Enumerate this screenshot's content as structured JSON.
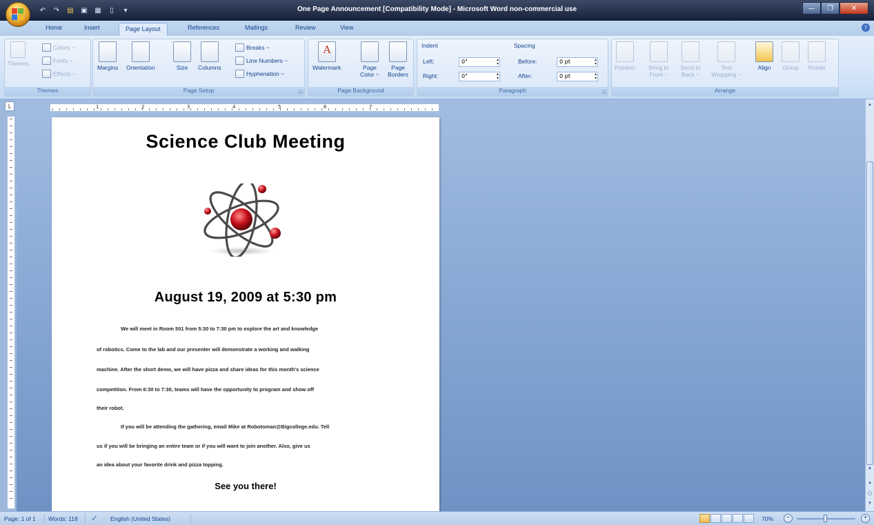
{
  "window": {
    "title": "One Page Announcement [Compatibility Mode] - Microsoft Word non-commercial use",
    "minimize": "—",
    "maximize": "❐",
    "close": "✕"
  },
  "quick_access": [
    {
      "icon": "undo-icon",
      "glyph": "↶"
    },
    {
      "icon": "redo-icon",
      "glyph": "↷"
    },
    {
      "icon": "open-folder-icon",
      "glyph": "▤"
    },
    {
      "icon": "print-preview-icon",
      "glyph": "▣"
    },
    {
      "icon": "save-icon",
      "glyph": "▦"
    },
    {
      "icon": "new-document-icon",
      "glyph": "▯"
    },
    {
      "icon": "customize-qat-icon",
      "glyph": "▾"
    }
  ],
  "tabs": [
    "Home",
    "Insert",
    "Page Layout",
    "References",
    "Mailings",
    "Review",
    "View"
  ],
  "active_tab": "Page Layout",
  "ribbon": {
    "themes": {
      "label": "Themes",
      "themes_button": "Themes",
      "colors": "Colors ~",
      "fonts": "Fonts ~",
      "effects": "Effects ~"
    },
    "page_setup": {
      "label": "Page Setup",
      "margins": "Margins",
      "orientation": "Orientation",
      "size": "Size",
      "columns": "Columns",
      "breaks": "Breaks ~",
      "line_numbers": "Line Numbers ~",
      "hyphenation": "Hyphenation ~"
    },
    "page_background": {
      "label": "Page Background",
      "watermark": "Watermark",
      "page_color": "Page Color ~",
      "page_borders": "Page Borders"
    },
    "paragraph": {
      "label": "Paragraph",
      "indent_header": "Indent",
      "left_label": "Left:",
      "left_value": "0\"",
      "right_label": "Right:",
      "right_value": "0\"",
      "spacing_header": "Spacing",
      "before_label": "Before:",
      "before_value": "0 pt",
      "after_label": "After:",
      "after_value": "0 pt"
    },
    "arrange": {
      "label": "Arrange",
      "position": "Position",
      "bring_to_front": "Bring to Front ~",
      "send_to_back": "Send to Back ~",
      "text_wrapping": "Text Wrapping ~",
      "align": "Align",
      "group": "Group",
      "rotate": "Rotate"
    }
  },
  "document": {
    "title": "Science Club Meeting",
    "date_line": "August 19, 2009 at 5:30 pm",
    "paragraph_lines": [
      "We will  meet in Room 501 from 5:30 to 7:30 pm to explore the art and knowledge",
      "of robotics. Come to the lab and our presenter will demonstrate a working and walking",
      "machine. After the short demo, we will have pizza and share ideas for this month's science",
      "competition. From 6:30 to 7:30, teams will have the opportunity to program and show off",
      "their robot.",
      "If you will be attending the gathering, email Mike at Robotoman@Bigcollege.edu. Tell",
      "us if you will be bringing an entire team or if you will want to join another. Also, give us",
      "an idea about your favorite drink and pizza topping."
    ],
    "closing": "See you there!",
    "image": "atom-icon"
  },
  "status_bar": {
    "page": "Page: 1 of 1",
    "words": "Words: 118",
    "proofing_icon": "spell-check-icon",
    "language": "English (United States)",
    "zoom": "70%",
    "zoom_out": "−",
    "zoom_in": "+"
  },
  "ruler_tab_glyph": "L",
  "colors": {
    "title_bar": "#1d2a45",
    "ribbon_bg": "#dbe8f8",
    "workspace": "#8cacd6",
    "accent": "#15428b",
    "atom_red": "#c8101a"
  }
}
